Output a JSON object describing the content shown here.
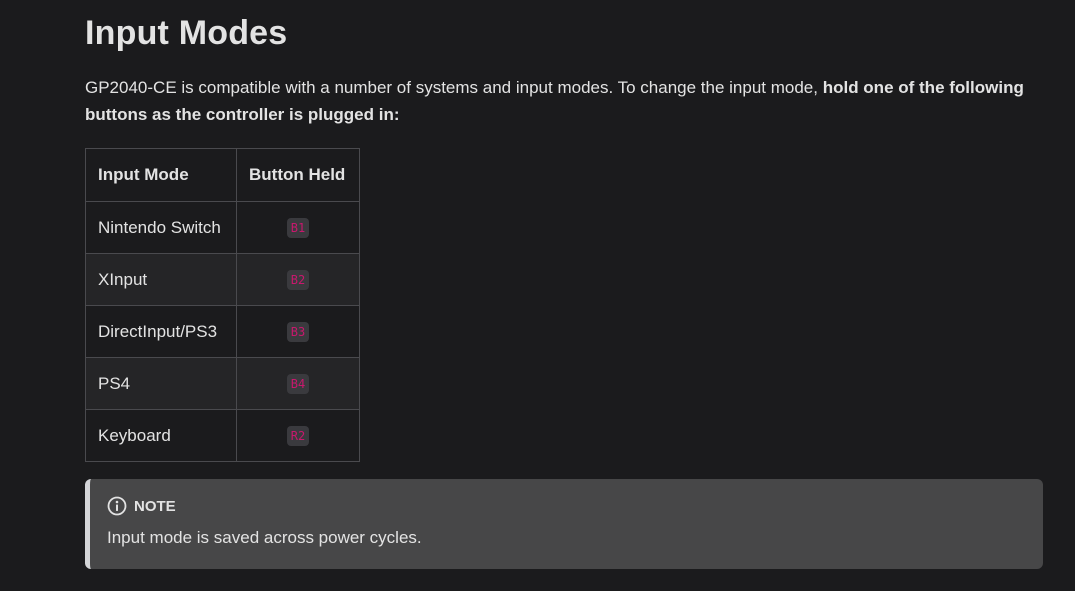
{
  "page": {
    "title": "Input Modes",
    "intro_plain": "GP2040-CE is compatible with a number of systems and input modes. To change the input mode, ",
    "intro_bold": "hold one of the following buttons as the controller is plugged in:"
  },
  "table": {
    "headers": [
      "Input Mode",
      "Button Held"
    ],
    "rows": [
      {
        "mode": "Nintendo Switch",
        "button": "B1"
      },
      {
        "mode": "XInput",
        "button": "B2"
      },
      {
        "mode": "DirectInput/PS3",
        "button": "B3"
      },
      {
        "mode": "PS4",
        "button": "B4"
      },
      {
        "mode": "Keyboard",
        "button": "R2"
      }
    ]
  },
  "note": {
    "icon": "info-icon",
    "label": "NOTE",
    "text": "Input mode is saved across power cycles."
  },
  "colors": {
    "background": "#1b1b1d",
    "text": "#e3e3e3",
    "kbd_text": "#c8186d",
    "note_bg": "#474748"
  }
}
